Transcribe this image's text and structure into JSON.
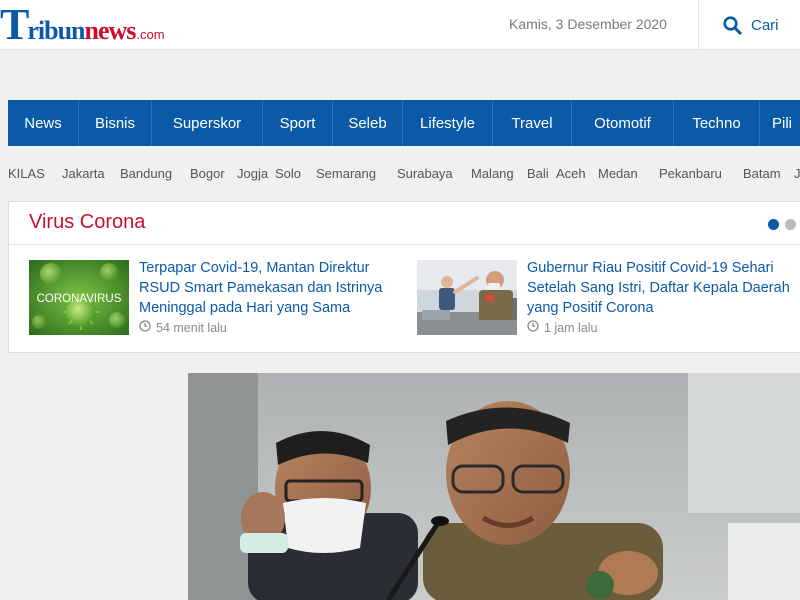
{
  "header": {
    "logo": {
      "t": "T",
      "ribun": "ribun",
      "news": "news",
      "com": ".com"
    },
    "date": "Kamis, 3 Desember 2020",
    "search_label": "Cari",
    "search_icon": "search-icon"
  },
  "nav": {
    "items": [
      "News",
      "Bisnis",
      "Superskor",
      "Sport",
      "Seleb",
      "Lifestyle",
      "Travel",
      "Otomotif",
      "Techno",
      "Pili"
    ]
  },
  "regions": {
    "items": [
      "KILAS",
      "Jakarta",
      "Bandung",
      "Bogor",
      "Jogja",
      "Solo",
      "Semarang",
      "Surabaya",
      "Malang",
      "Bali",
      "Aceh",
      "Medan",
      "Pekanbaru",
      "Batam",
      "Ja"
    ]
  },
  "virus_corona": {
    "title": "Virus Corona",
    "articles": [
      {
        "headline": "Terpapar Covid-19, Mantan Direktur RSUD Smart Pamekasan dan Istrinya Meninggal pada Hari yang Sama",
        "time": "54 menit lalu",
        "thumb_text": "CORONAVIRUS"
      },
      {
        "headline": "Gubernur Riau Positif Covid-19 Sehari Setelah Sang Istri, Daftar Kepala Daerah yang Positif Corona",
        "time": "1 jam lalu"
      }
    ],
    "carousel_dots": {
      "total": 2,
      "active_index": 0
    }
  },
  "colors": {
    "brand_blue": "#0b5aa8",
    "brand_red": "#c8102e",
    "background": "#f0f0f0"
  }
}
